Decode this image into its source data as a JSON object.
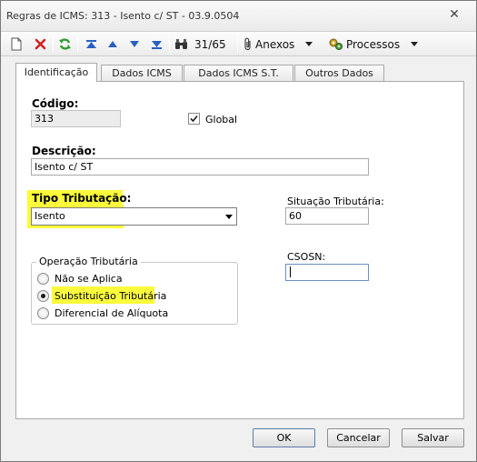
{
  "window": {
    "title": "Regras de ICMS: 313 - Isento c/ ST - 03.9.0504",
    "close_glyph": "✕"
  },
  "toolbar": {
    "record_position": "31/65",
    "attachments_label": "Anexos",
    "processes_label": "Processos",
    "icons": [
      "new-icon",
      "delete-icon",
      "refresh-icon",
      "first-record-icon",
      "previous-record-icon",
      "next-record-icon",
      "last-record-icon",
      "binoculars-icon",
      "paperclip-icon",
      "gears-icon"
    ]
  },
  "tabs": [
    {
      "label": "Identificação",
      "active": true
    },
    {
      "label": "Dados ICMS",
      "active": false
    },
    {
      "label": "Dados ICMS S.T.",
      "active": false
    },
    {
      "label": "Outros Dados",
      "active": false
    }
  ],
  "form": {
    "codigo_label": "Código:",
    "codigo_value": "313",
    "global_label": "Global",
    "global_checked": true,
    "descricao_label": "Descrição:",
    "descricao_value": "Isento c/ ST",
    "tipo_tributacao_label": "Tipo Tributação:",
    "tipo_tributacao_value": "Isento",
    "situacao_label": "Situação Tributária:",
    "situacao_value": "60",
    "csosn_label": "CSOSN:",
    "csosn_value": ""
  },
  "operacao": {
    "title": "Operação Tributária",
    "options": [
      {
        "label": "Não se Aplica",
        "selected": false
      },
      {
        "label": "Substituição Tributária",
        "selected": true
      },
      {
        "label": "Diferencial de Alíquota",
        "selected": false
      }
    ]
  },
  "buttons": {
    "ok": "OK",
    "cancel": "Cancelar",
    "save": "Salvar"
  },
  "colors": {
    "highlight": "#fbfb3c",
    "delete_red": "#d42020",
    "refresh_green": "#2f9e2f",
    "nav_blue": "#2a5fc4"
  }
}
